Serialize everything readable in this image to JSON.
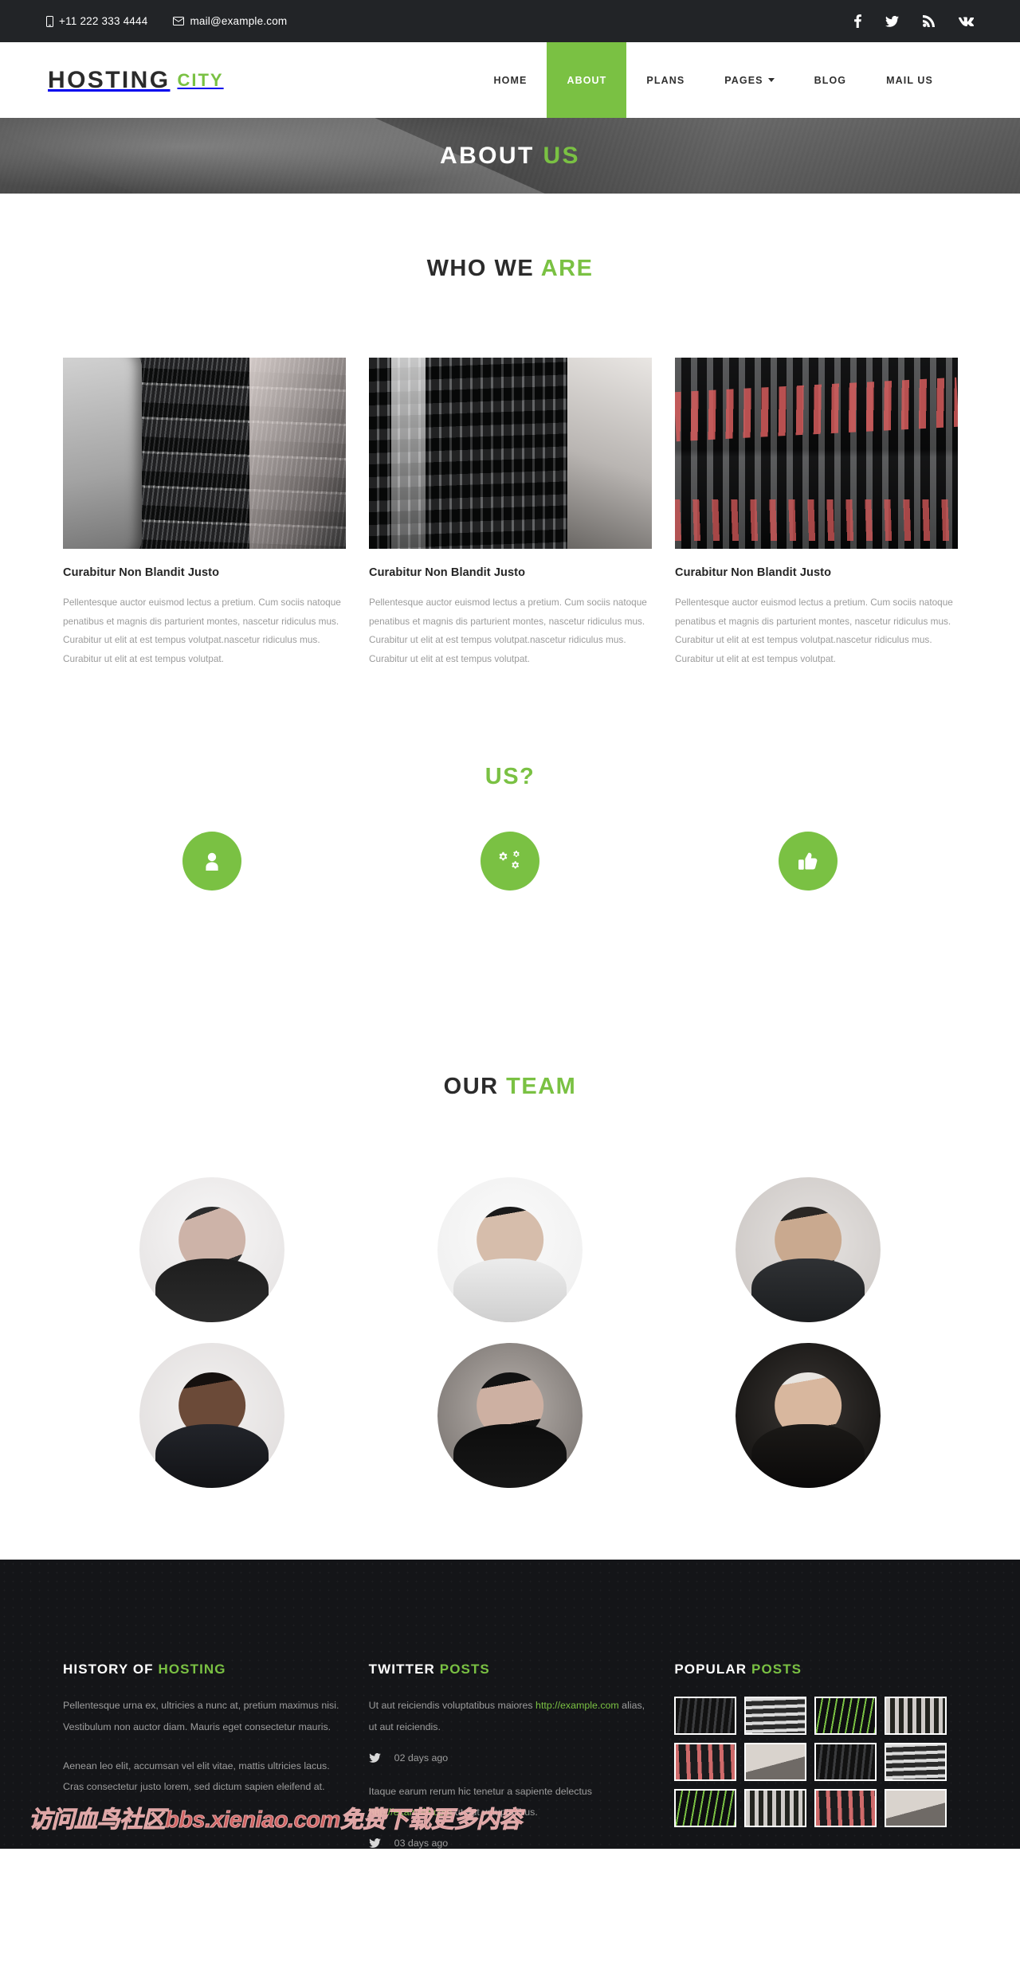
{
  "topbar": {
    "phone": "+11 222 333 4444",
    "email": "mail@example.com",
    "phone_icon": "mobile-icon",
    "email_icon": "envelope-icon",
    "socials": [
      {
        "name": "facebook-icon",
        "label": "Facebook"
      },
      {
        "name": "twitter-icon",
        "label": "Twitter"
      },
      {
        "name": "rss-icon",
        "label": "RSS"
      },
      {
        "name": "vk-icon",
        "label": "VK"
      }
    ]
  },
  "nav": {
    "logo_main": "HOSTING",
    "logo_accent": "CITY",
    "items": [
      {
        "label": "HOME",
        "active": false,
        "dropdown": false
      },
      {
        "label": "ABOUT",
        "active": true,
        "dropdown": false
      },
      {
        "label": "PLANS",
        "active": false,
        "dropdown": false
      },
      {
        "label": "PAGES",
        "active": false,
        "dropdown": true
      },
      {
        "label": "BLOG",
        "active": false,
        "dropdown": false
      },
      {
        "label": "MAIL US",
        "active": false,
        "dropdown": false
      }
    ]
  },
  "banner": {
    "title_main": "ABOUT",
    "title_accent": "US"
  },
  "who_we_are": {
    "title_main": "WHO WE",
    "title_accent": "ARE",
    "cards": [
      {
        "image": "server-rack-photo",
        "title": "Curabitur Non Blandit Justo",
        "text": "Pellentesque auctor euismod lectus a pretium. Cum sociis natoque penatibus et magnis dis parturient montes, nascetur ridiculus mus. Curabitur ut elit at est tempus volutpat.nascetur ridiculus mus. Curabitur ut elit at est tempus volutpat."
      },
      {
        "image": "data-center-photo",
        "title": "Curabitur Non Blandit Justo",
        "text": "Pellentesque auctor euismod lectus a pretium. Cum sociis natoque penatibus et magnis dis parturient montes, nascetur ridiculus mus. Curabitur ut elit at est tempus volutpat.nascetur ridiculus mus. Curabitur ut elit at est tempus volutpat."
      },
      {
        "image": "network-cables-photo",
        "title": "Curabitur Non Blandit Justo",
        "text": "Pellentesque auctor euismod lectus a pretium. Cum sociis natoque penatibus et magnis dis parturient montes, nascetur ridiculus mus. Curabitur ut elit at est tempus volutpat.nascetur ridiculus mus. Curabitur ut elit at est tempus volutpat."
      }
    ]
  },
  "why_us": {
    "title_main": "",
    "title_accent": "US?",
    "features": [
      {
        "icon": "user-icon"
      },
      {
        "icon": "cogs-icon"
      },
      {
        "icon": "thumbs-up-icon"
      }
    ]
  },
  "team": {
    "title_main": "OUR",
    "title_accent": "TEAM",
    "members": [
      {
        "photo": "team-member-1"
      },
      {
        "photo": "team-member-2"
      },
      {
        "photo": "team-member-3"
      },
      {
        "photo": "team-member-4"
      },
      {
        "photo": "team-member-5"
      },
      {
        "photo": "team-member-6"
      }
    ]
  },
  "footer": {
    "history": {
      "title_main": "HISTORY OF",
      "title_accent": "HOSTING",
      "p1": "Pellentesque urna ex, ultricies a nunc at, pretium maximus nisi. Vestibulum non auctor diam. Mauris eget consectetur mauris.",
      "p2": "Aenean leo elit, accumsan vel elit vitae, mattis ultricies lacus. Cras consectetur justo lorem, sed dictum sapien eleifend at."
    },
    "twitter": {
      "title_main": "TWITTER",
      "title_accent": "POSTS",
      "posts": [
        {
          "text_before": "Ut aut reiciendis voluptatibus maiores ",
          "link": "http://example.com",
          "text_after": " alias, ut aut reiciendis.",
          "time": "02 days ago",
          "icon": "twitter-icon"
        },
        {
          "text_before": "Itaque earum rerum hic tenetur a sapiente delectus ",
          "link": "http://example.com",
          "text_after": " ut aut voluptatibus.",
          "time": "03 days ago",
          "icon": "twitter-icon"
        }
      ]
    },
    "popular": {
      "title_main": "POPULAR",
      "title_accent": "POSTS",
      "thumbs": [
        "server-rack-thumb",
        "server-front-thumb",
        "switch-led-thumb",
        "rack-row-thumb",
        "red-cables-thumb",
        "green-cable-thumb",
        "server-rack-thumb-2",
        "server-front-thumb-2",
        "switch-led-thumb-2",
        "rack-row-thumb-2",
        "red-cables-thumb-2",
        "green-cable-thumb-2"
      ]
    },
    "watermark": "访问血鸟社区bbs.xieniao.com免费下载更多内容"
  },
  "colors": {
    "accent": "#7ac143",
    "dark": "#222427",
    "footer_bg": "#141518",
    "body_text": "#9b9b9b"
  }
}
